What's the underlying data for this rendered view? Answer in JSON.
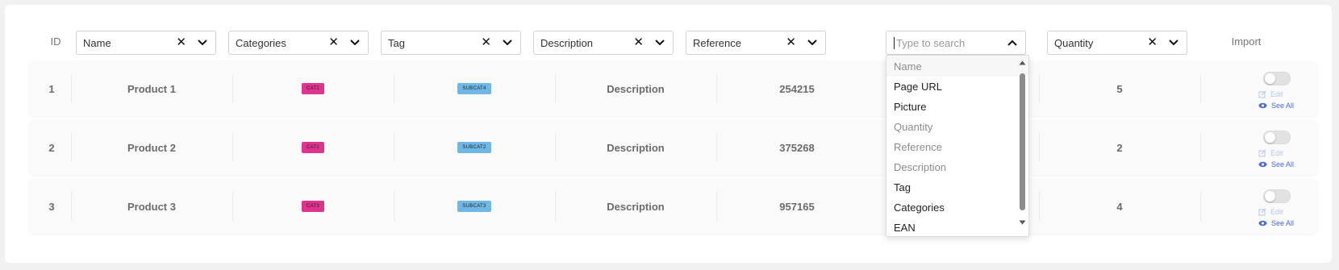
{
  "header": {
    "id_label": "ID",
    "import_label": "Import",
    "filters": [
      {
        "label": "Name"
      },
      {
        "label": "Categories"
      },
      {
        "label": "Tag"
      },
      {
        "label": "Description"
      },
      {
        "label": "Reference"
      },
      {
        "placeholder": "Type to search"
      },
      {
        "label": "Quantity"
      }
    ]
  },
  "rows": [
    {
      "id": "1",
      "name": "Product 1",
      "category": "CAT1",
      "tag": "SUBCAT4",
      "description": "Description",
      "reference": "254215",
      "quantity": "5",
      "edit": "Edit",
      "see_all": "See All"
    },
    {
      "id": "2",
      "name": "Product 2",
      "category": "CAT1",
      "tag": "SUBCAT2",
      "description": "Description",
      "reference": "375268",
      "quantity": "2",
      "edit": "Edit",
      "see_all": "See All"
    },
    {
      "id": "3",
      "name": "Product 3",
      "category": "CAT3",
      "tag": "SUBCAT3",
      "description": "Description",
      "reference": "957165",
      "quantity": "4",
      "edit": "Edit",
      "see_all": "See All"
    }
  ],
  "dropdown": {
    "options": [
      {
        "label": "Name",
        "enabled": false
      },
      {
        "label": "Page URL",
        "enabled": true
      },
      {
        "label": "Picture",
        "enabled": true
      },
      {
        "label": "Quantity",
        "enabled": false
      },
      {
        "label": "Reference",
        "enabled": false
      },
      {
        "label": "Description",
        "enabled": false
      },
      {
        "label": "Tag",
        "enabled": true
      },
      {
        "label": "Categories",
        "enabled": true
      },
      {
        "label": "EAN",
        "enabled": true
      }
    ]
  },
  "colors": {
    "category_badge": "#e0338f",
    "tag_badge": "#6fb8e6",
    "link": "#4a6fd6"
  },
  "icons": {
    "clear": "close-icon",
    "expand": "chevron-down-icon",
    "collapse": "chevron-up-icon",
    "edit": "edit-icon",
    "view": "eye-icon"
  }
}
